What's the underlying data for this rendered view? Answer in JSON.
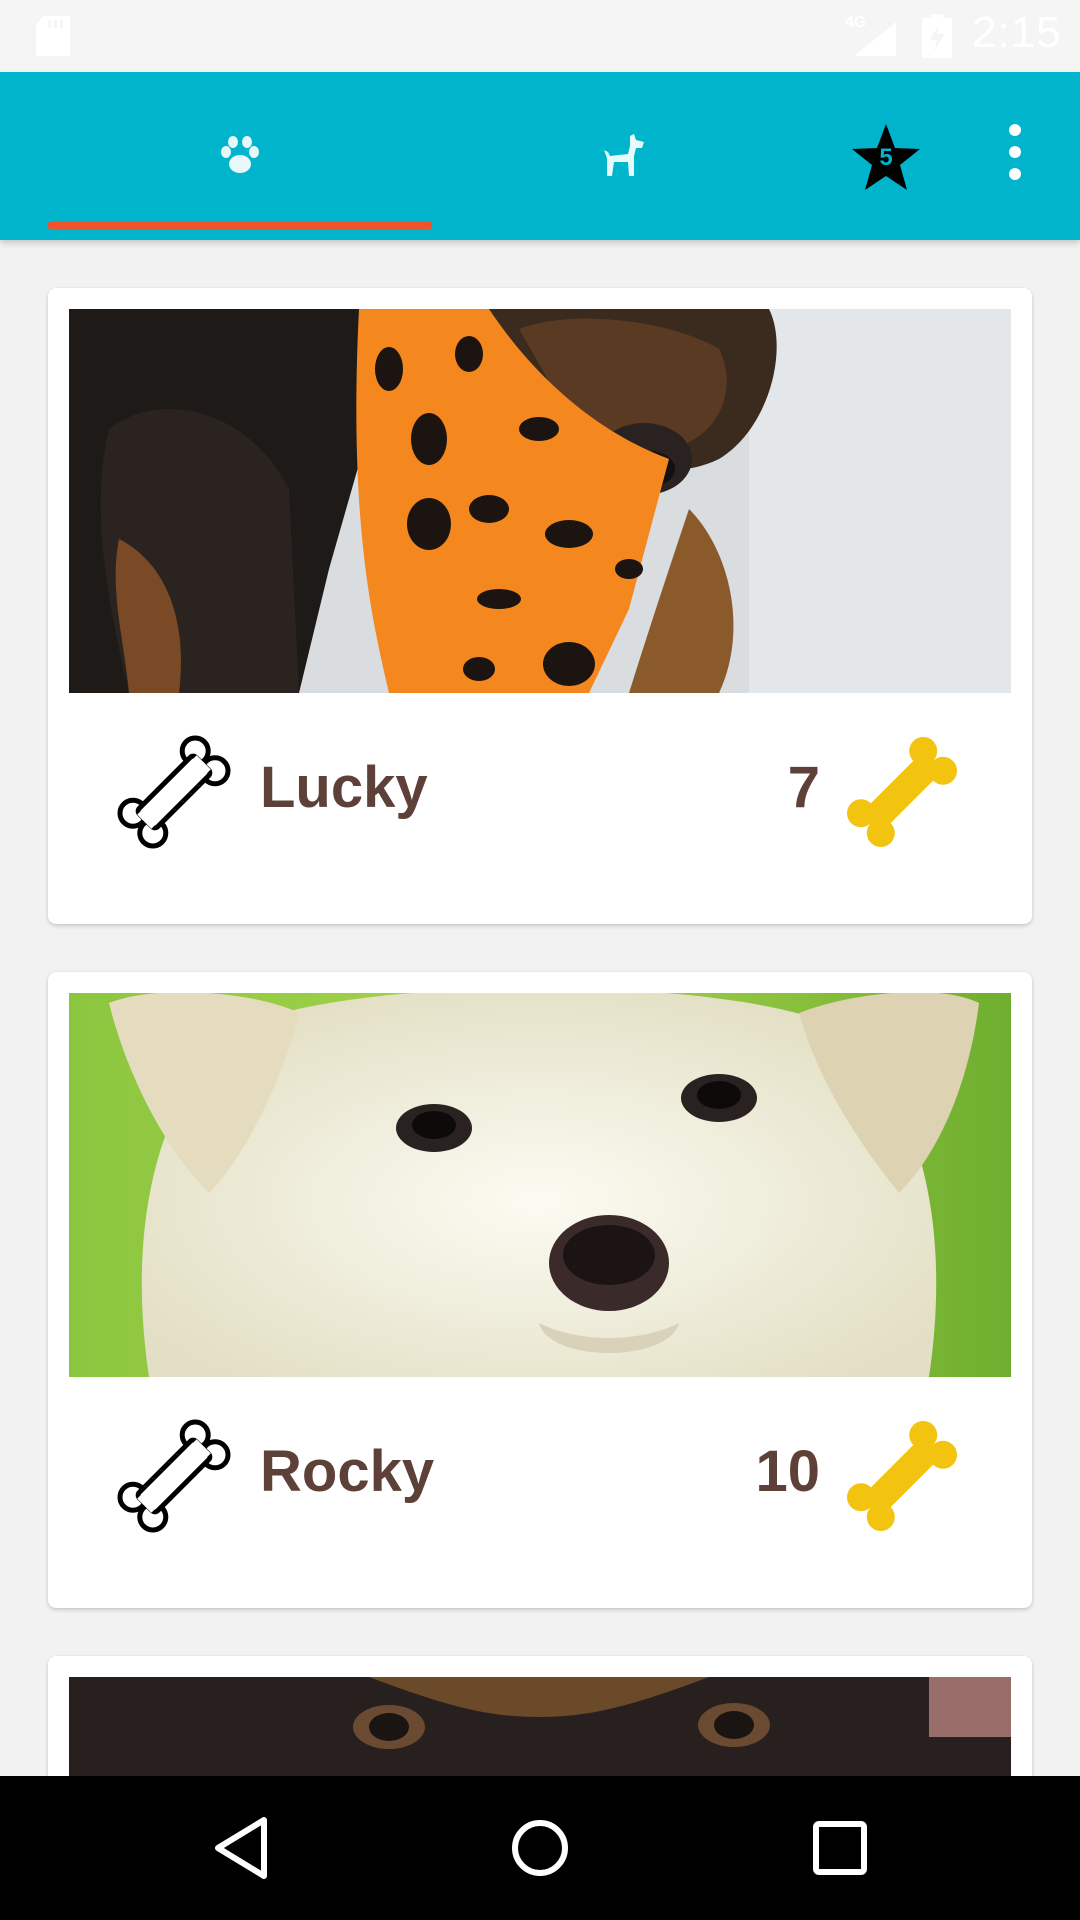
{
  "status_bar": {
    "network_type": "4G",
    "clock": "2:15",
    "icons": [
      "sd-card-icon",
      "signal-icon",
      "battery-icon"
    ]
  },
  "app_bar": {
    "background": "#00b4cc",
    "indicator_color": "#f0522b",
    "tabs": [
      {
        "icon": "paw-icon",
        "selected": true
      },
      {
        "icon": "dog-icon",
        "selected": false
      }
    ],
    "favorites": {
      "icon": "star-icon",
      "count": "5"
    },
    "menu_icon": "overflow-menu-icon"
  },
  "feed": {
    "name_color": "#5d4037",
    "bone_color": "#f2c40f",
    "items": [
      {
        "name": "Lucky",
        "likes": "7",
        "photo": "black-and-tan puppy wearing orange polka-dot bandana"
      },
      {
        "name": "Rocky",
        "likes": "10",
        "photo": "cream labrador puppy on green background"
      },
      {
        "name": "",
        "likes": "",
        "photo": "black-and-tan puppy (partially visible)"
      }
    ]
  },
  "nav_bar": {
    "buttons": [
      "back-icon",
      "home-icon",
      "recents-icon"
    ]
  }
}
